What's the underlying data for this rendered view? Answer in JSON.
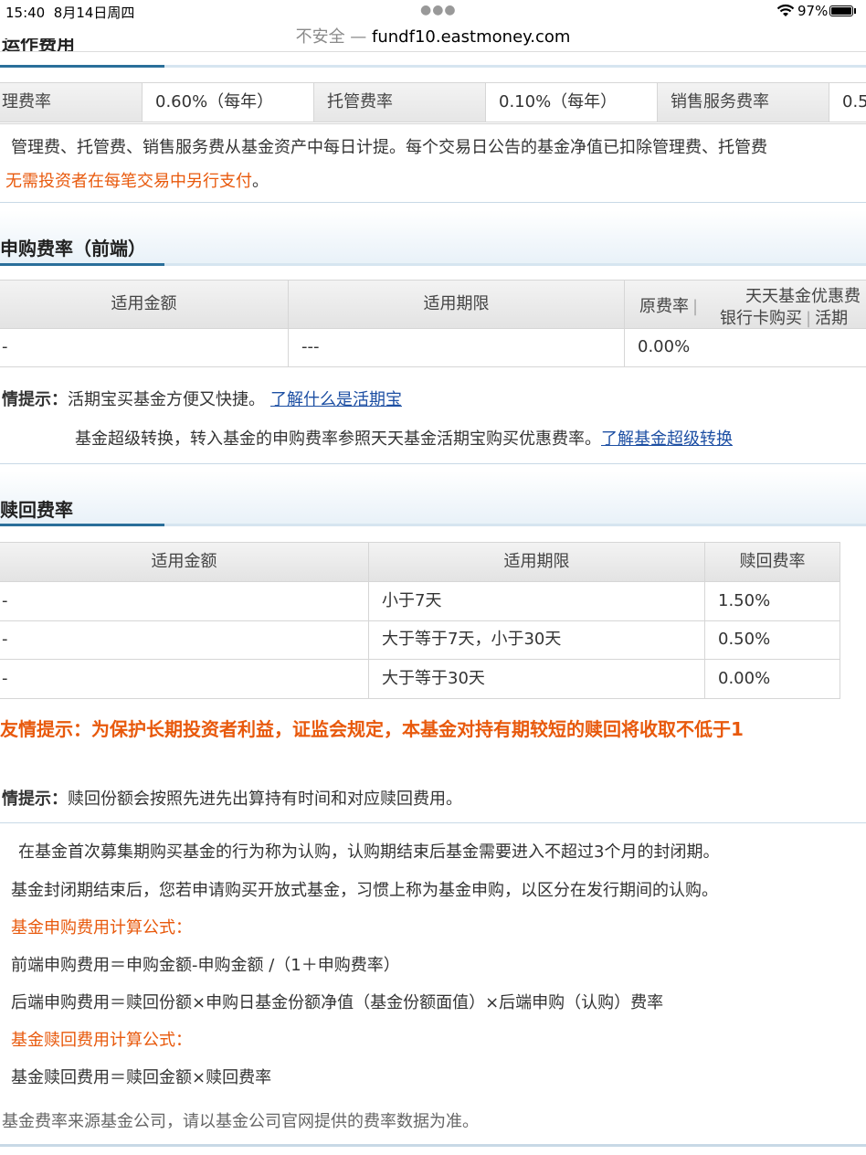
{
  "status_bar": {
    "time": "15:40",
    "date": "8月14日周四",
    "battery": "97%"
  },
  "address_bar": {
    "security_label": "不安全",
    "separator": " — ",
    "url": "fundf10.eastmoney.com"
  },
  "operating_fees": {
    "title_partial": "运作费用",
    "items": [
      {
        "label": "理费率",
        "value": "0.60%（每年）"
      },
      {
        "label": "托管费率",
        "value": "0.10%（每年）"
      },
      {
        "label": "销售服务费率",
        "value": "0.5"
      }
    ],
    "note_line1": "管理费、托管费、销售服务费从基金资产中每日计提。每个交易日公告的基金净值已扣除管理费、托管费",
    "note_line2": "无需投资者在每笔交易中另行支付",
    "note_line2_end": "。"
  },
  "purchase_fees": {
    "title": "申购费率（前端）",
    "headers": {
      "amount": "适用金额",
      "period": "适用期限",
      "original_rate": "原费率",
      "discount_title": "天天基金优惠费",
      "discount_bank": "银行卡购买",
      "discount_sep": "|",
      "discount_demand": "活期"
    },
    "row": {
      "amount": "-",
      "period": "---",
      "original_rate": "0.00%"
    },
    "tip_label": "情提示：",
    "tip_text": "活期宝买基金方便又快捷。",
    "tip_link": "了解什么是活期宝",
    "tip2_text": "基金超级转换，转入基金的申购费率参照天天基金活期宝购买优惠费率。",
    "tip2_link": "了解基金超级转换"
  },
  "redemption_fees": {
    "title": "赎回费率",
    "headers": {
      "amount": "适用金额",
      "period": "适用期限",
      "rate": "赎回费率"
    },
    "rows": [
      {
        "amount": "-",
        "period": "小于7天",
        "rate": "1.50%"
      },
      {
        "amount": "-",
        "period": "大于等于7天，小于30天",
        "rate": "0.50%"
      },
      {
        "amount": "-",
        "period": "大于等于30天",
        "rate": "0.00%"
      }
    ],
    "warning": "友情提示：为保护长期投资者利益，证监会规定，本基金对持有期较短的赎回将收取不低于1",
    "tip_label": "情提示：",
    "tip_text": "赎回份额会按照先进先出算持有时间和对应赎回费用。"
  },
  "explanation": {
    "line1": "在基金首次募集期购买基金的行为称为认购，认购期结束后基金需要进入不超过3个月的封闭期。",
    "line2": "基金封闭期结束后，您若申请购买开放式基金，习惯上称为基金申购，以区分在发行期间的认购。",
    "purchase_formula_title": "基金申购费用计算公式：",
    "purchase_formula_1": "前端申购费用＝申购金额-申购金额 /（1＋申购费率）",
    "purchase_formula_2": "后端申购费用＝赎回份额×申购日基金份额净值（基金份额面值）×后端申购（认购）费率",
    "redeem_formula_title": "基金赎回费用计算公式：",
    "redeem_formula": "基金赎回费用＝赎回金额×赎回费率"
  },
  "footer_note": "基金费率来源基金公司，请以基金公司官网提供的费率数据为准。",
  "colors": {
    "accent_orange": "#e8590c",
    "link_blue": "#1d4fa3",
    "section_blue": "#2a6f9a"
  }
}
